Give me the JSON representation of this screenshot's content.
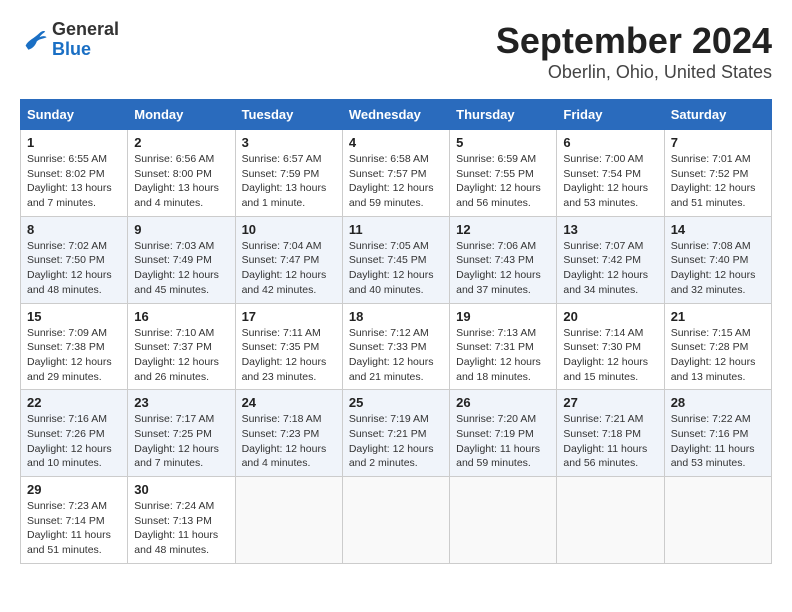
{
  "header": {
    "logo": {
      "general": "General",
      "blue": "Blue"
    },
    "title": "September 2024",
    "location": "Oberlin, Ohio, United States"
  },
  "calendar": {
    "days_of_week": [
      "Sunday",
      "Monday",
      "Tuesday",
      "Wednesday",
      "Thursday",
      "Friday",
      "Saturday"
    ],
    "weeks": [
      [
        {
          "day": "1",
          "sunrise": "6:55 AM",
          "sunset": "8:02 PM",
          "daylight": "13 hours and 7 minutes."
        },
        {
          "day": "2",
          "sunrise": "6:56 AM",
          "sunset": "8:00 PM",
          "daylight": "13 hours and 4 minutes."
        },
        {
          "day": "3",
          "sunrise": "6:57 AM",
          "sunset": "7:59 PM",
          "daylight": "13 hours and 1 minute."
        },
        {
          "day": "4",
          "sunrise": "6:58 AM",
          "sunset": "7:57 PM",
          "daylight": "12 hours and 59 minutes."
        },
        {
          "day": "5",
          "sunrise": "6:59 AM",
          "sunset": "7:55 PM",
          "daylight": "12 hours and 56 minutes."
        },
        {
          "day": "6",
          "sunrise": "7:00 AM",
          "sunset": "7:54 PM",
          "daylight": "12 hours and 53 minutes."
        },
        {
          "day": "7",
          "sunrise": "7:01 AM",
          "sunset": "7:52 PM",
          "daylight": "12 hours and 51 minutes."
        }
      ],
      [
        {
          "day": "8",
          "sunrise": "7:02 AM",
          "sunset": "7:50 PM",
          "daylight": "12 hours and 48 minutes."
        },
        {
          "day": "9",
          "sunrise": "7:03 AM",
          "sunset": "7:49 PM",
          "daylight": "12 hours and 45 minutes."
        },
        {
          "day": "10",
          "sunrise": "7:04 AM",
          "sunset": "7:47 PM",
          "daylight": "12 hours and 42 minutes."
        },
        {
          "day": "11",
          "sunrise": "7:05 AM",
          "sunset": "7:45 PM",
          "daylight": "12 hours and 40 minutes."
        },
        {
          "day": "12",
          "sunrise": "7:06 AM",
          "sunset": "7:43 PM",
          "daylight": "12 hours and 37 minutes."
        },
        {
          "day": "13",
          "sunrise": "7:07 AM",
          "sunset": "7:42 PM",
          "daylight": "12 hours and 34 minutes."
        },
        {
          "day": "14",
          "sunrise": "7:08 AM",
          "sunset": "7:40 PM",
          "daylight": "12 hours and 32 minutes."
        }
      ],
      [
        {
          "day": "15",
          "sunrise": "7:09 AM",
          "sunset": "7:38 PM",
          "daylight": "12 hours and 29 minutes."
        },
        {
          "day": "16",
          "sunrise": "7:10 AM",
          "sunset": "7:37 PM",
          "daylight": "12 hours and 26 minutes."
        },
        {
          "day": "17",
          "sunrise": "7:11 AM",
          "sunset": "7:35 PM",
          "daylight": "12 hours and 23 minutes."
        },
        {
          "day": "18",
          "sunrise": "7:12 AM",
          "sunset": "7:33 PM",
          "daylight": "12 hours and 21 minutes."
        },
        {
          "day": "19",
          "sunrise": "7:13 AM",
          "sunset": "7:31 PM",
          "daylight": "12 hours and 18 minutes."
        },
        {
          "day": "20",
          "sunrise": "7:14 AM",
          "sunset": "7:30 PM",
          "daylight": "12 hours and 15 minutes."
        },
        {
          "day": "21",
          "sunrise": "7:15 AM",
          "sunset": "7:28 PM",
          "daylight": "12 hours and 13 minutes."
        }
      ],
      [
        {
          "day": "22",
          "sunrise": "7:16 AM",
          "sunset": "7:26 PM",
          "daylight": "12 hours and 10 minutes."
        },
        {
          "day": "23",
          "sunrise": "7:17 AM",
          "sunset": "7:25 PM",
          "daylight": "12 hours and 7 minutes."
        },
        {
          "day": "24",
          "sunrise": "7:18 AM",
          "sunset": "7:23 PM",
          "daylight": "12 hours and 4 minutes."
        },
        {
          "day": "25",
          "sunrise": "7:19 AM",
          "sunset": "7:21 PM",
          "daylight": "12 hours and 2 minutes."
        },
        {
          "day": "26",
          "sunrise": "7:20 AM",
          "sunset": "7:19 PM",
          "daylight": "11 hours and 59 minutes."
        },
        {
          "day": "27",
          "sunrise": "7:21 AM",
          "sunset": "7:18 PM",
          "daylight": "11 hours and 56 minutes."
        },
        {
          "day": "28",
          "sunrise": "7:22 AM",
          "sunset": "7:16 PM",
          "daylight": "11 hours and 53 minutes."
        }
      ],
      [
        {
          "day": "29",
          "sunrise": "7:23 AM",
          "sunset": "7:14 PM",
          "daylight": "11 hours and 51 minutes."
        },
        {
          "day": "30",
          "sunrise": "7:24 AM",
          "sunset": "7:13 PM",
          "daylight": "11 hours and 48 minutes."
        },
        null,
        null,
        null,
        null,
        null
      ]
    ]
  }
}
